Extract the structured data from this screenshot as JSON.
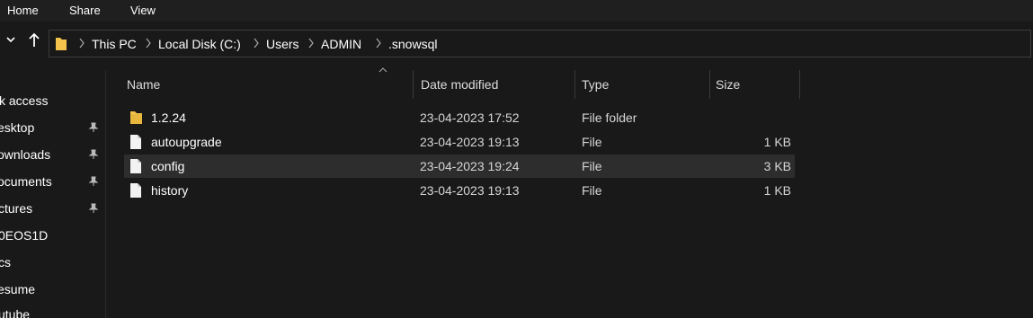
{
  "ribbon": {
    "tabs": [
      {
        "label": "Home"
      },
      {
        "label": "Share"
      },
      {
        "label": "View"
      }
    ]
  },
  "address": {
    "crumbs": [
      {
        "label": "This PC"
      },
      {
        "label": "Local Disk (C:)"
      },
      {
        "label": "Users"
      },
      {
        "label": "ADMIN"
      },
      {
        "label": ".snowsql"
      }
    ]
  },
  "nav": {
    "items": [
      {
        "label": "ck access",
        "pinned": false
      },
      {
        "label": "esktop",
        "pinned": true
      },
      {
        "label": "ownloads",
        "pinned": true
      },
      {
        "label": "ocuments",
        "pinned": true
      },
      {
        "label": "ctures",
        "pinned": true
      },
      {
        "label": "0EOS1D",
        "pinned": false
      },
      {
        "label": "cs",
        "pinned": false
      },
      {
        "label": "esume",
        "pinned": false
      },
      {
        "label": "utube",
        "pinned": false
      }
    ]
  },
  "columns": {
    "name": "Name",
    "date": "Date modified",
    "type": "Type",
    "size": "Size"
  },
  "files": [
    {
      "name": "1.2.24",
      "date": "23-04-2023 17:52",
      "type": "File folder",
      "size": "",
      "kind": "folder-icon"
    },
    {
      "name": "autoupgrade",
      "date": "23-04-2023 19:13",
      "type": "File",
      "size": "1 KB",
      "kind": "file-icon"
    },
    {
      "name": "config",
      "date": "23-04-2023 19:24",
      "type": "File",
      "size": "3 KB",
      "kind": "file-icon",
      "selected": true
    },
    {
      "name": "history",
      "date": "23-04-2023 19:13",
      "type": "File",
      "size": "1 KB",
      "kind": "file-icon"
    }
  ],
  "colors": {
    "background": "#191919",
    "folder": "#f3c34b",
    "selection": "#2d2d2d"
  }
}
